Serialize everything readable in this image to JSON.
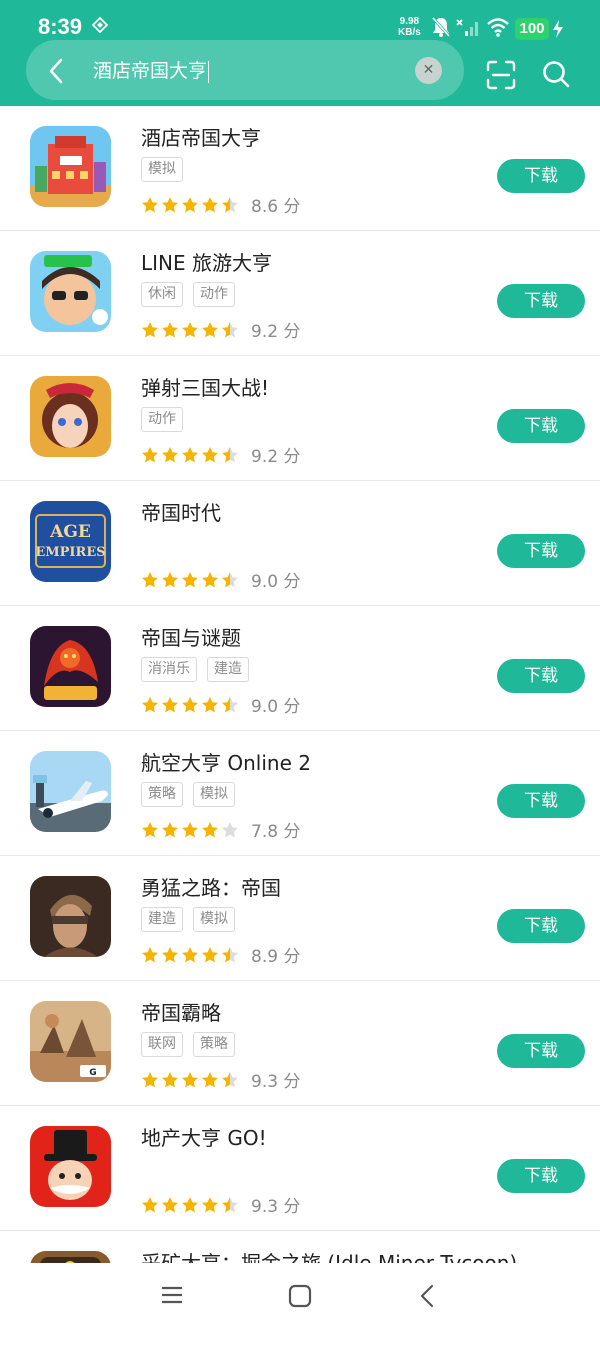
{
  "status": {
    "time": "8:39",
    "net_speed_value": "9.98",
    "net_speed_unit": "KB/s",
    "battery": "100"
  },
  "search": {
    "query": "酒店帝国大亨"
  },
  "icons": {
    "back": "back-arrow-icon",
    "clear": "clear-icon",
    "scan": "scan-icon",
    "search": "search-icon"
  },
  "colors": {
    "accent": "#1fb99a",
    "star": "#f5b400",
    "star_empty": "#dcdcdc"
  },
  "apps": [
    {
      "name": "酒店帝国大亨",
      "tags": [
        "模拟"
      ],
      "score": "8.6 分",
      "stars": 4.5,
      "button": "下载"
    },
    {
      "name": "LINE 旅游大亨",
      "tags": [
        "休闲",
        "动作"
      ],
      "score": "9.2 分",
      "stars": 4.5,
      "button": "下载"
    },
    {
      "name": "弹射三国大战!",
      "tags": [
        "动作"
      ],
      "score": "9.2 分",
      "stars": 4.5,
      "button": "下载"
    },
    {
      "name": "帝国时代",
      "tags": [],
      "score": "9.0 分",
      "stars": 4.5,
      "button": "下载"
    },
    {
      "name": "帝国与谜题",
      "tags": [
        "消消乐",
        "建造"
      ],
      "score": "9.0 分",
      "stars": 4.5,
      "button": "下载"
    },
    {
      "name": "航空大亨 Online 2",
      "tags": [
        "策略",
        "模拟"
      ],
      "score": "7.8 分",
      "stars": 4,
      "button": "下载"
    },
    {
      "name": "勇猛之路：帝国",
      "tags": [
        "建造",
        "模拟"
      ],
      "score": "8.9 分",
      "stars": 4.5,
      "button": "下载"
    },
    {
      "name": "帝国霸略",
      "tags": [
        "联网",
        "策略"
      ],
      "score": "9.3 分",
      "stars": 4.5,
      "button": "下载"
    },
    {
      "name": "地产大亨 GO!",
      "tags": [],
      "score": "9.3 分",
      "stars": 4.5,
      "button": "下载"
    },
    {
      "name": "采矿大亨：掘金之旅 (Idle Miner Tycoon)",
      "tags": [],
      "score": "",
      "stars": 0,
      "button": ""
    }
  ],
  "nav": {
    "menu": "menu-icon",
    "home": "home-icon",
    "back": "back-icon"
  }
}
